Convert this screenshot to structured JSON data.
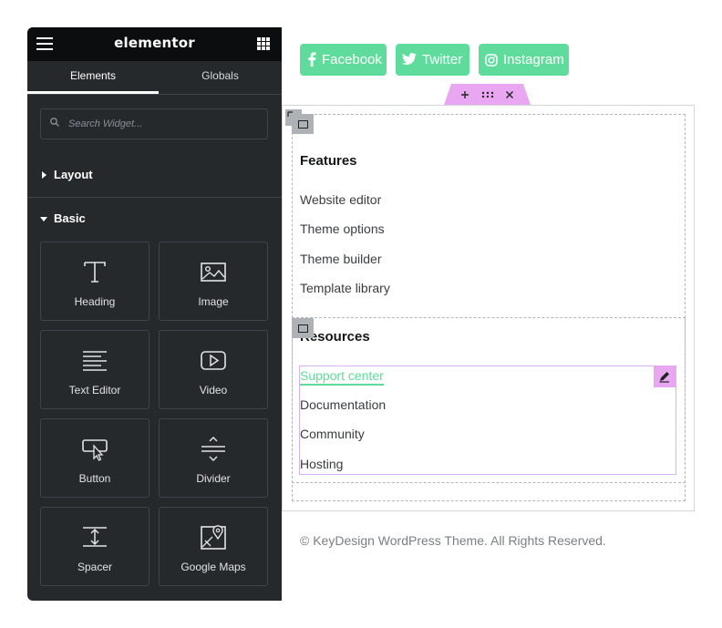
{
  "app": {
    "logo": "elementor",
    "menu_icon": "hamburger-icon",
    "apps_icon": "grid-icon"
  },
  "tabs": [
    {
      "label": "Elements",
      "active": true
    },
    {
      "label": "Globals",
      "active": false
    }
  ],
  "search": {
    "placeholder": "Search Widget...",
    "icon": "search-icon"
  },
  "sections": {
    "layout": {
      "label": "Layout",
      "expanded": false
    },
    "basic": {
      "label": "Basic",
      "expanded": true
    }
  },
  "widgets": [
    {
      "label": "Heading",
      "icon": "heading-icon"
    },
    {
      "label": "Image",
      "icon": "image-icon"
    },
    {
      "label": "Text Editor",
      "icon": "text-editor-icon"
    },
    {
      "label": "Video",
      "icon": "video-icon"
    },
    {
      "label": "Button",
      "icon": "button-icon"
    },
    {
      "label": "Divider",
      "icon": "divider-icon"
    },
    {
      "label": "Spacer",
      "icon": "spacer-icon"
    },
    {
      "label": "Google Maps",
      "icon": "google-maps-icon"
    }
  ],
  "social": [
    {
      "label": "Facebook",
      "icon": "facebook-icon"
    },
    {
      "label": "Twitter",
      "icon": "twitter-icon"
    },
    {
      "label": "Instagram",
      "icon": "instagram-icon"
    }
  ],
  "container_handle": {
    "add_icon": "plus-icon",
    "drag_icon": "drag-handle-icon",
    "close_icon": "close-icon"
  },
  "features": {
    "heading": "Features",
    "links": [
      "Website editor",
      "Theme options",
      "Theme builder",
      "Template library"
    ]
  },
  "resources": {
    "heading": "Resources",
    "links": [
      "Support center",
      "Documentation",
      "Community",
      "Hosting"
    ],
    "active_link": "Support center"
  },
  "footer": {
    "copyright": "© KeyDesign WordPress Theme. All Rights Reserved."
  },
  "colors": {
    "panel_bg": "#26292c",
    "topbar_bg": "#0c0d0e",
    "accent_green": "#5fdc9b",
    "handle_pink": "#e8a7f0"
  }
}
